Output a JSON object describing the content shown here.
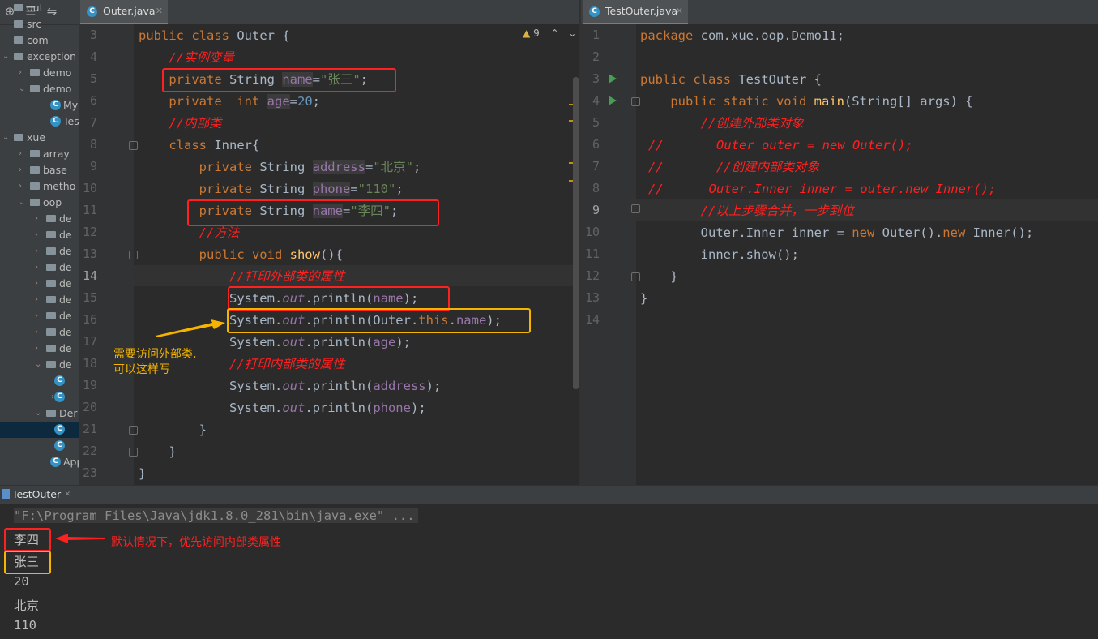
{
  "sidebar": {
    "items": [
      {
        "label": "out",
        "type": "folder"
      },
      {
        "label": "src",
        "type": "folder"
      },
      {
        "label": "com",
        "type": "folder"
      },
      {
        "label": "exception",
        "type": "folder"
      },
      {
        "label": "demo",
        "type": "folder"
      },
      {
        "label": "demo",
        "type": "folder"
      },
      {
        "label": "My",
        "type": "class"
      },
      {
        "label": "Tes",
        "type": "class"
      },
      {
        "label": "xue",
        "type": "folder"
      },
      {
        "label": "array",
        "type": "folder"
      },
      {
        "label": "base",
        "type": "folder"
      },
      {
        "label": "metho",
        "type": "folder"
      },
      {
        "label": "oop",
        "type": "folder"
      },
      {
        "label": "de",
        "type": "folder"
      },
      {
        "label": "de",
        "type": "folder"
      },
      {
        "label": "de",
        "type": "folder"
      },
      {
        "label": "de",
        "type": "folder"
      },
      {
        "label": "de",
        "type": "folder"
      },
      {
        "label": "de",
        "type": "folder"
      },
      {
        "label": "de",
        "type": "folder"
      },
      {
        "label": "de",
        "type": "folder"
      },
      {
        "label": "de",
        "type": "folder"
      },
      {
        "label": "de",
        "type": "folder"
      },
      {
        "label": "",
        "type": "class"
      },
      {
        "label": "",
        "type": "class"
      },
      {
        "label": "Der",
        "type": "folder"
      },
      {
        "label": "",
        "type": "class"
      },
      {
        "label": "",
        "type": "class"
      },
      {
        "label": "App",
        "type": "class"
      }
    ]
  },
  "left_editor": {
    "tab_label": "Outer.java",
    "warnings": "9",
    "line_numbers": [
      "3",
      "4",
      "5",
      "6",
      "7",
      "8",
      "9",
      "10",
      "11",
      "12",
      "13",
      "14",
      "15",
      "16",
      "17",
      "18",
      "19",
      "20",
      "21",
      "22",
      "23"
    ],
    "current_line": "14",
    "annotation": "需要访问外部类,\n可以这样写"
  },
  "right_editor": {
    "tab_label": "TestOuter.java",
    "line_numbers": [
      "1",
      "2",
      "3",
      "4",
      "5",
      "6",
      "7",
      "8",
      "9",
      "10",
      "11",
      "12",
      "13",
      "14"
    ],
    "current_line": "9"
  },
  "console": {
    "tab_label": "TestOuter",
    "command": "\"F:\\Program Files\\Java\\jdk1.8.0_281\\bin\\java.exe\" ...",
    "output": [
      "李四",
      "张三",
      "20",
      "北京",
      "110"
    ],
    "annotation": "默认情况下，优先访问内部类属性"
  },
  "colors": {
    "keyword": "#cc7832",
    "string": "#6a8759",
    "field": "#9876aa",
    "method": "#ffc66d",
    "annotation_red": "#ff2020",
    "annotation_yellow": "#f5b400"
  }
}
